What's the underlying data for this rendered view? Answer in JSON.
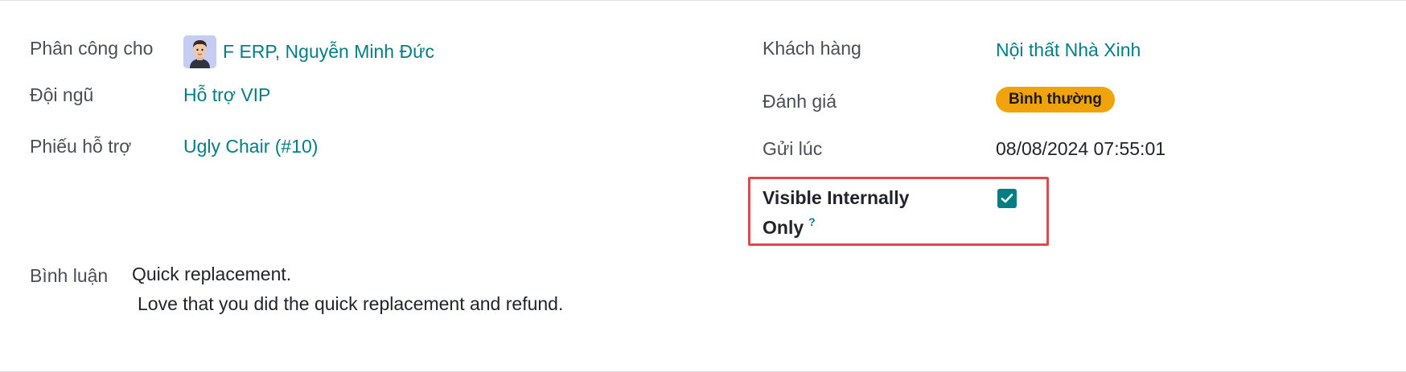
{
  "fields": {
    "assigned_label": "Phân công cho",
    "assigned_value": "F ERP, Nguyễn Minh Đức",
    "team_label": "Đội ngũ",
    "team_value": "Hỗ trợ VIP",
    "ticket_label": "Phiếu hỗ trợ",
    "ticket_value": "Ugly Chair (#10)",
    "customer_label": "Khách hàng",
    "customer_value": "Nội thất Nhà Xinh",
    "rating_label": "Đánh giá",
    "rating_value": "Bình thường",
    "submitted_label": "Gửi lúc",
    "submitted_value": "08/08/2024 07:55:01",
    "visible_label_line1": "Visible Internally",
    "visible_label_line2": "Only",
    "visible_help": "?",
    "visible_checked": true
  },
  "comment": {
    "label": "Bình luận",
    "line1": "Quick replacement.",
    "line2": "Love that you did the quick replacement and refund."
  },
  "colors": {
    "link": "#017e84",
    "badge": "#f0a30a",
    "highlight": "#e0484e"
  },
  "icons": {
    "avatar": "avatar-icon",
    "checkbox": "check-icon"
  }
}
